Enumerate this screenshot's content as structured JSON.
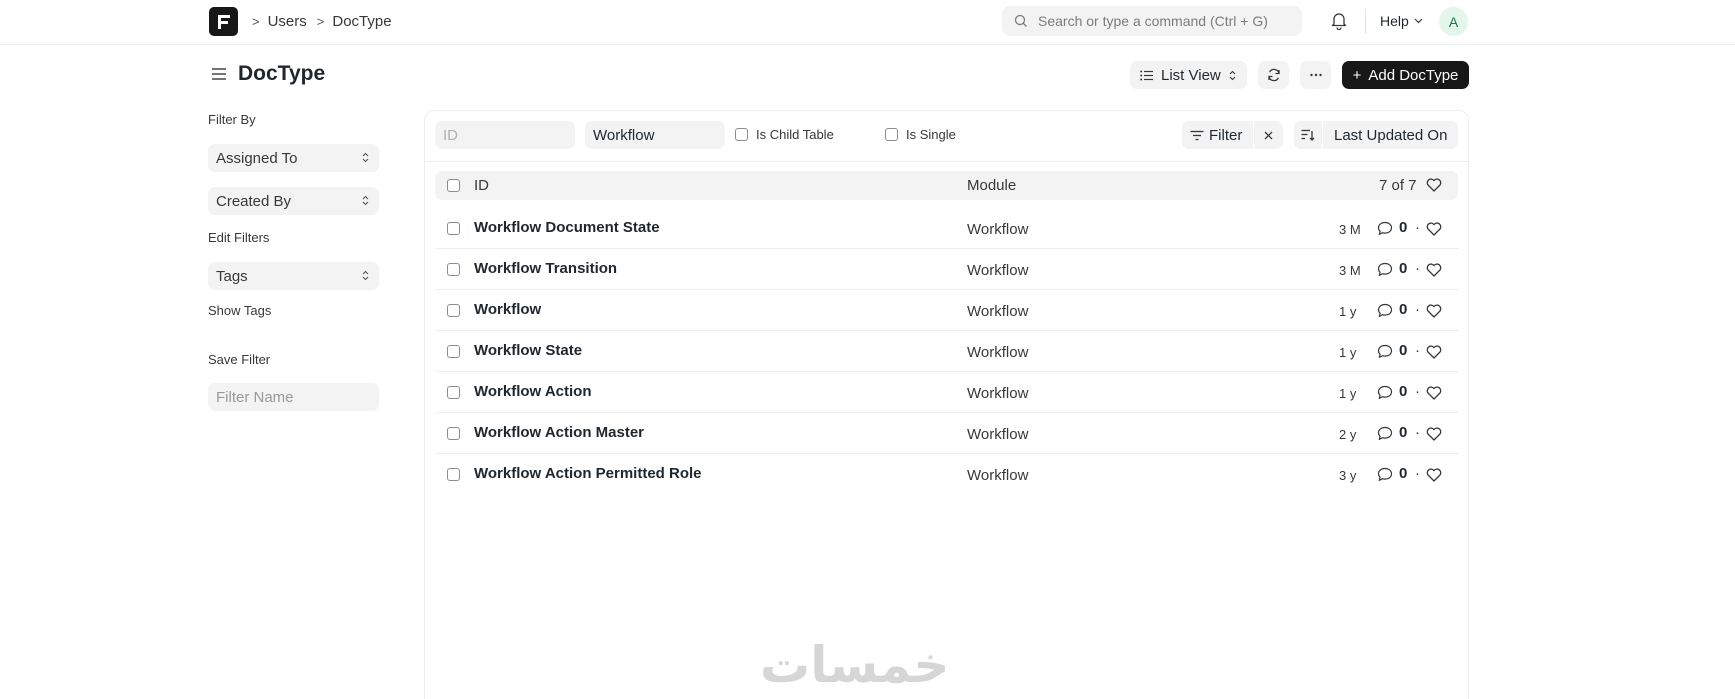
{
  "navbar": {
    "breadcrumbs": [
      ">",
      "Users",
      ">",
      "DocType"
    ],
    "search_placeholder": "Search or type a command (Ctrl + G)",
    "help_label": "Help",
    "avatar_initial": "A"
  },
  "page": {
    "title": "DocType",
    "list_view_label": "List View",
    "add_button_label": "Add DocType",
    "add_button_plus": "+"
  },
  "sidebar": {
    "filter_by_label": "Filter By",
    "assigned_to_label": "Assigned To",
    "created_by_label": "Created By",
    "edit_filters_label": "Edit Filters",
    "tags_label": "Tags",
    "show_tags_label": "Show Tags",
    "save_filter_label": "Save Filter",
    "filter_name_placeholder": "Filter Name"
  },
  "filters": {
    "id_placeholder": "ID",
    "name_value": "Workflow",
    "is_child_table_label": "Is Child Table",
    "is_single_label": "Is Single",
    "filter_label": "Filter",
    "sort_label": "Last Updated On"
  },
  "list": {
    "header_id": "ID",
    "header_module": "Module",
    "count_label": "7 of 7",
    "rows": [
      {
        "id": "Workflow Document State",
        "module": "Workflow",
        "modified": "3 M",
        "comments": "0"
      },
      {
        "id": "Workflow Transition",
        "module": "Workflow",
        "modified": "3 M",
        "comments": "0"
      },
      {
        "id": "Workflow",
        "module": "Workflow",
        "modified": "1 y",
        "comments": "0"
      },
      {
        "id": "Workflow State",
        "module": "Workflow",
        "modified": "1 y",
        "comments": "0"
      },
      {
        "id": "Workflow Action",
        "module": "Workflow",
        "modified": "1 y",
        "comments": "0"
      },
      {
        "id": "Workflow Action Master",
        "module": "Workflow",
        "modified": "2 y",
        "comments": "0"
      },
      {
        "id": "Workflow Action Permitted Role",
        "module": "Workflow",
        "modified": "3 y",
        "comments": "0"
      }
    ]
  },
  "watermark": "خمسات"
}
